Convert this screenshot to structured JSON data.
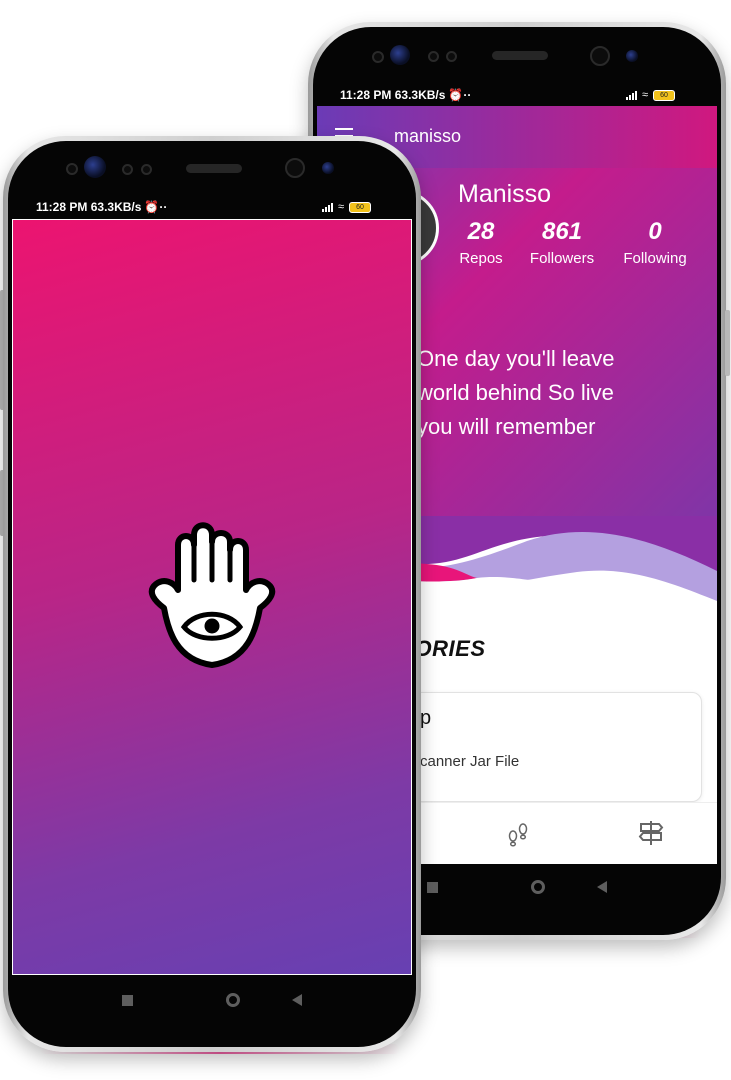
{
  "status": {
    "time": "11:28 PM",
    "speed": "63.3KB/s",
    "battery": "60"
  },
  "profile_screen": {
    "appbar_title": "manisso",
    "name": "Manisso",
    "stats": [
      {
        "value": "28",
        "label": "Repos"
      },
      {
        "value": "861",
        "label": "Followers"
      },
      {
        "value": "0",
        "label": "Following"
      }
    ],
    "quote_lines": [
      "One day you'll leave",
      "world behind So live",
      "you will remember"
    ],
    "section_title": "TORIES",
    "repo_card": {
      "title": "p",
      "description": "canner Jar File"
    },
    "bottom_nav_icons": [
      "footprints-icon",
      "signpost-icon"
    ]
  },
  "splash_screen": {
    "logo_icon": "hamsa-hand-eye-icon",
    "colors": {
      "gradient_start": "#ec1470",
      "gradient_end": "#6740b2"
    }
  },
  "colors": {
    "accent_pink": "#d0187f",
    "accent_purple": "#6b3bb6",
    "wave_lavender": "#b4a0e0"
  }
}
